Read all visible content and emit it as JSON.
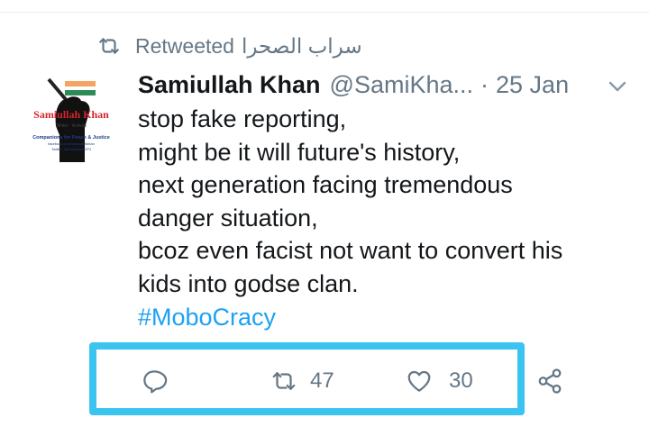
{
  "retweet_notice": {
    "label": "Retweeted",
    "retweeter": "سراب الصحرا"
  },
  "tweet": {
    "display_name": "Samiullah Khan",
    "handle": "@SamiKha...",
    "separator": "·",
    "time": "25 Jan",
    "lines": [
      "stop fake reporting,",
      "might be it will future's history,",
      "next generation facing tremendous",
      "danger situation,",
      "bcoz even facist not want to convert his",
      "kids into godse clan."
    ],
    "hashtag": "#MoboCracy"
  },
  "avatar": {
    "name": "Samiullah Khan",
    "tagline": "Writer · Activist",
    "org": "Companions for Peace & Justice",
    "facebook": "facebook.com/samiullahkhan",
    "twitter": "Twitter: @SamiKhanCPJ"
  },
  "actions": {
    "retweets": "47",
    "likes": "30"
  },
  "colors": {
    "accent": "#1da1f2",
    "muted": "#657786",
    "highlight": "#3bc4ef"
  },
  "icons": [
    "retweet-icon",
    "chevron-down-icon",
    "reply-icon",
    "retweet-icon",
    "heart-icon",
    "share-icon"
  ]
}
